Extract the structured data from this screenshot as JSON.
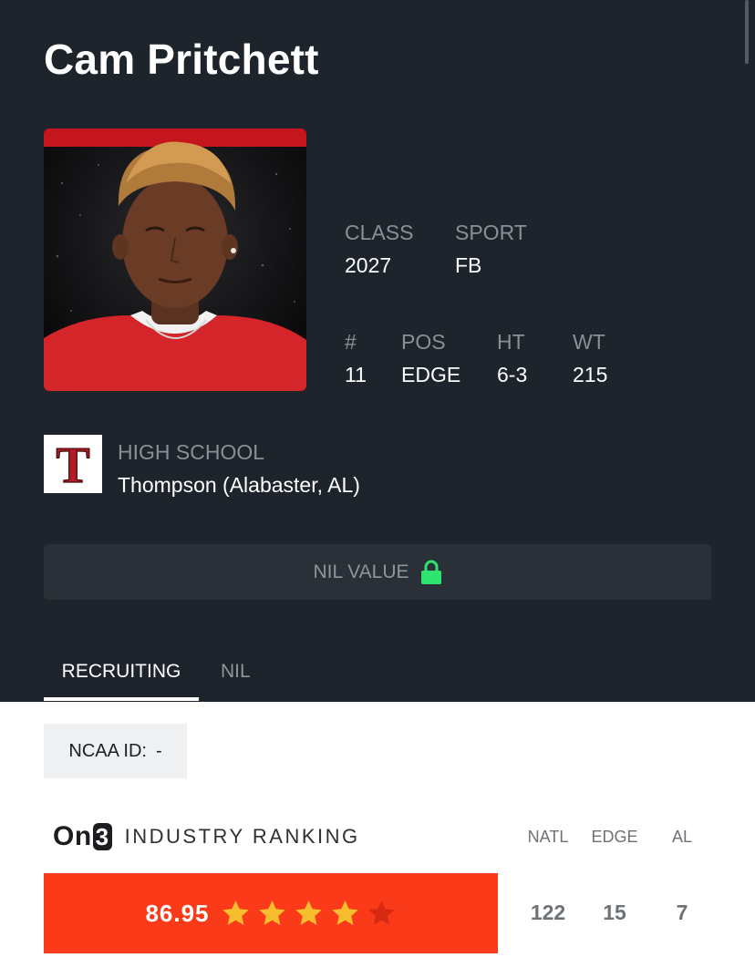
{
  "player": {
    "name": "Cam Pritchett"
  },
  "stats": {
    "class": {
      "label": "CLASS",
      "value": "2027"
    },
    "sport": {
      "label": "SPORT",
      "value": "FB"
    },
    "number": {
      "label": "#",
      "value": "11"
    },
    "position": {
      "label": "POS",
      "value": "EDGE"
    },
    "height": {
      "label": "HT",
      "value": "6-3"
    },
    "weight": {
      "label": "WT",
      "value": "215"
    }
  },
  "school": {
    "label": "HIGH SCHOOL",
    "name": "Thompson (Alabaster, AL)",
    "logo_letter": "T"
  },
  "nil_value": {
    "label": "NIL VALUE",
    "icon": "lock-icon"
  },
  "tabs": [
    {
      "label": "RECRUITING",
      "active": true
    },
    {
      "label": "NIL",
      "active": false
    }
  ],
  "ncaa": {
    "label": "NCAA ID:",
    "value": "-"
  },
  "ranking": {
    "brand_prefix": "On",
    "brand_suffix": "3",
    "title": "INDUSTRY RANKING",
    "score": "86.95",
    "stars_filled": 4,
    "stars_total": 5,
    "columns": [
      {
        "label": "NATL",
        "value": "122"
      },
      {
        "label": "EDGE",
        "value": "15"
      },
      {
        "label": "AL",
        "value": "7"
      }
    ]
  },
  "colors": {
    "background_dark": "#1e242b",
    "accent_orange": "#fa3a19",
    "star_gold": "#f7bd2e",
    "star_empty": "#d82a12",
    "lock_green": "#2ee36f",
    "school_red": "#b01c22"
  }
}
